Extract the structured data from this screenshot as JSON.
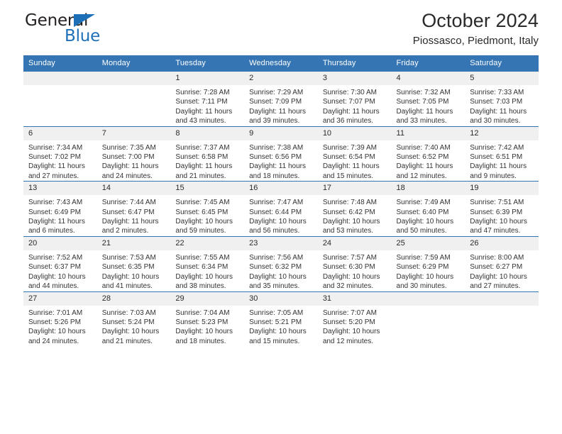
{
  "brand": {
    "name_top": "General",
    "name_bottom": "Blue",
    "color_dark": "#231f20",
    "color_blue": "#1d70b8"
  },
  "header": {
    "title": "October 2024",
    "subtitle": "Piossasco, Piedmont, Italy"
  },
  "theme": {
    "header_row_bg": "#3575b4",
    "header_row_text": "#ffffff",
    "daynum_bg": "#f0f0f0",
    "grid_line": "#3575b4",
    "body_text": "#333333"
  },
  "weekday_headers": [
    "Sunday",
    "Monday",
    "Tuesday",
    "Wednesday",
    "Thursday",
    "Friday",
    "Saturday"
  ],
  "weeks": [
    [
      {
        "day": "",
        "empty": true,
        "lines": []
      },
      {
        "day": "",
        "empty": true,
        "lines": []
      },
      {
        "day": "1",
        "empty": false,
        "lines": [
          "Sunrise: 7:28 AM",
          "Sunset: 7:11 PM",
          "Daylight: 11 hours",
          "and 43 minutes."
        ]
      },
      {
        "day": "2",
        "empty": false,
        "lines": [
          "Sunrise: 7:29 AM",
          "Sunset: 7:09 PM",
          "Daylight: 11 hours",
          "and 39 minutes."
        ]
      },
      {
        "day": "3",
        "empty": false,
        "lines": [
          "Sunrise: 7:30 AM",
          "Sunset: 7:07 PM",
          "Daylight: 11 hours",
          "and 36 minutes."
        ]
      },
      {
        "day": "4",
        "empty": false,
        "lines": [
          "Sunrise: 7:32 AM",
          "Sunset: 7:05 PM",
          "Daylight: 11 hours",
          "and 33 minutes."
        ]
      },
      {
        "day": "5",
        "empty": false,
        "lines": [
          "Sunrise: 7:33 AM",
          "Sunset: 7:03 PM",
          "Daylight: 11 hours",
          "and 30 minutes."
        ]
      }
    ],
    [
      {
        "day": "6",
        "empty": false,
        "lines": [
          "Sunrise: 7:34 AM",
          "Sunset: 7:02 PM",
          "Daylight: 11 hours",
          "and 27 minutes."
        ]
      },
      {
        "day": "7",
        "empty": false,
        "lines": [
          "Sunrise: 7:35 AM",
          "Sunset: 7:00 PM",
          "Daylight: 11 hours",
          "and 24 minutes."
        ]
      },
      {
        "day": "8",
        "empty": false,
        "lines": [
          "Sunrise: 7:37 AM",
          "Sunset: 6:58 PM",
          "Daylight: 11 hours",
          "and 21 minutes."
        ]
      },
      {
        "day": "9",
        "empty": false,
        "lines": [
          "Sunrise: 7:38 AM",
          "Sunset: 6:56 PM",
          "Daylight: 11 hours",
          "and 18 minutes."
        ]
      },
      {
        "day": "10",
        "empty": false,
        "lines": [
          "Sunrise: 7:39 AM",
          "Sunset: 6:54 PM",
          "Daylight: 11 hours",
          "and 15 minutes."
        ]
      },
      {
        "day": "11",
        "empty": false,
        "lines": [
          "Sunrise: 7:40 AM",
          "Sunset: 6:52 PM",
          "Daylight: 11 hours",
          "and 12 minutes."
        ]
      },
      {
        "day": "12",
        "empty": false,
        "lines": [
          "Sunrise: 7:42 AM",
          "Sunset: 6:51 PM",
          "Daylight: 11 hours",
          "and 9 minutes."
        ]
      }
    ],
    [
      {
        "day": "13",
        "empty": false,
        "lines": [
          "Sunrise: 7:43 AM",
          "Sunset: 6:49 PM",
          "Daylight: 11 hours",
          "and 6 minutes."
        ]
      },
      {
        "day": "14",
        "empty": false,
        "lines": [
          "Sunrise: 7:44 AM",
          "Sunset: 6:47 PM",
          "Daylight: 11 hours",
          "and 2 minutes."
        ]
      },
      {
        "day": "15",
        "empty": false,
        "lines": [
          "Sunrise: 7:45 AM",
          "Sunset: 6:45 PM",
          "Daylight: 10 hours",
          "and 59 minutes."
        ]
      },
      {
        "day": "16",
        "empty": false,
        "lines": [
          "Sunrise: 7:47 AM",
          "Sunset: 6:44 PM",
          "Daylight: 10 hours",
          "and 56 minutes."
        ]
      },
      {
        "day": "17",
        "empty": false,
        "lines": [
          "Sunrise: 7:48 AM",
          "Sunset: 6:42 PM",
          "Daylight: 10 hours",
          "and 53 minutes."
        ]
      },
      {
        "day": "18",
        "empty": false,
        "lines": [
          "Sunrise: 7:49 AM",
          "Sunset: 6:40 PM",
          "Daylight: 10 hours",
          "and 50 minutes."
        ]
      },
      {
        "day": "19",
        "empty": false,
        "lines": [
          "Sunrise: 7:51 AM",
          "Sunset: 6:39 PM",
          "Daylight: 10 hours",
          "and 47 minutes."
        ]
      }
    ],
    [
      {
        "day": "20",
        "empty": false,
        "lines": [
          "Sunrise: 7:52 AM",
          "Sunset: 6:37 PM",
          "Daylight: 10 hours",
          "and 44 minutes."
        ]
      },
      {
        "day": "21",
        "empty": false,
        "lines": [
          "Sunrise: 7:53 AM",
          "Sunset: 6:35 PM",
          "Daylight: 10 hours",
          "and 41 minutes."
        ]
      },
      {
        "day": "22",
        "empty": false,
        "lines": [
          "Sunrise: 7:55 AM",
          "Sunset: 6:34 PM",
          "Daylight: 10 hours",
          "and 38 minutes."
        ]
      },
      {
        "day": "23",
        "empty": false,
        "lines": [
          "Sunrise: 7:56 AM",
          "Sunset: 6:32 PM",
          "Daylight: 10 hours",
          "and 35 minutes."
        ]
      },
      {
        "day": "24",
        "empty": false,
        "lines": [
          "Sunrise: 7:57 AM",
          "Sunset: 6:30 PM",
          "Daylight: 10 hours",
          "and 32 minutes."
        ]
      },
      {
        "day": "25",
        "empty": false,
        "lines": [
          "Sunrise: 7:59 AM",
          "Sunset: 6:29 PM",
          "Daylight: 10 hours",
          "and 30 minutes."
        ]
      },
      {
        "day": "26",
        "empty": false,
        "lines": [
          "Sunrise: 8:00 AM",
          "Sunset: 6:27 PM",
          "Daylight: 10 hours",
          "and 27 minutes."
        ]
      }
    ],
    [
      {
        "day": "27",
        "empty": false,
        "lines": [
          "Sunrise: 7:01 AM",
          "Sunset: 5:26 PM",
          "Daylight: 10 hours",
          "and 24 minutes."
        ]
      },
      {
        "day": "28",
        "empty": false,
        "lines": [
          "Sunrise: 7:03 AM",
          "Sunset: 5:24 PM",
          "Daylight: 10 hours",
          "and 21 minutes."
        ]
      },
      {
        "day": "29",
        "empty": false,
        "lines": [
          "Sunrise: 7:04 AM",
          "Sunset: 5:23 PM",
          "Daylight: 10 hours",
          "and 18 minutes."
        ]
      },
      {
        "day": "30",
        "empty": false,
        "lines": [
          "Sunrise: 7:05 AM",
          "Sunset: 5:21 PM",
          "Daylight: 10 hours",
          "and 15 minutes."
        ]
      },
      {
        "day": "31",
        "empty": false,
        "lines": [
          "Sunrise: 7:07 AM",
          "Sunset: 5:20 PM",
          "Daylight: 10 hours",
          "and 12 minutes."
        ]
      },
      {
        "day": "",
        "empty": true,
        "lines": []
      },
      {
        "day": "",
        "empty": true,
        "lines": []
      }
    ]
  ]
}
